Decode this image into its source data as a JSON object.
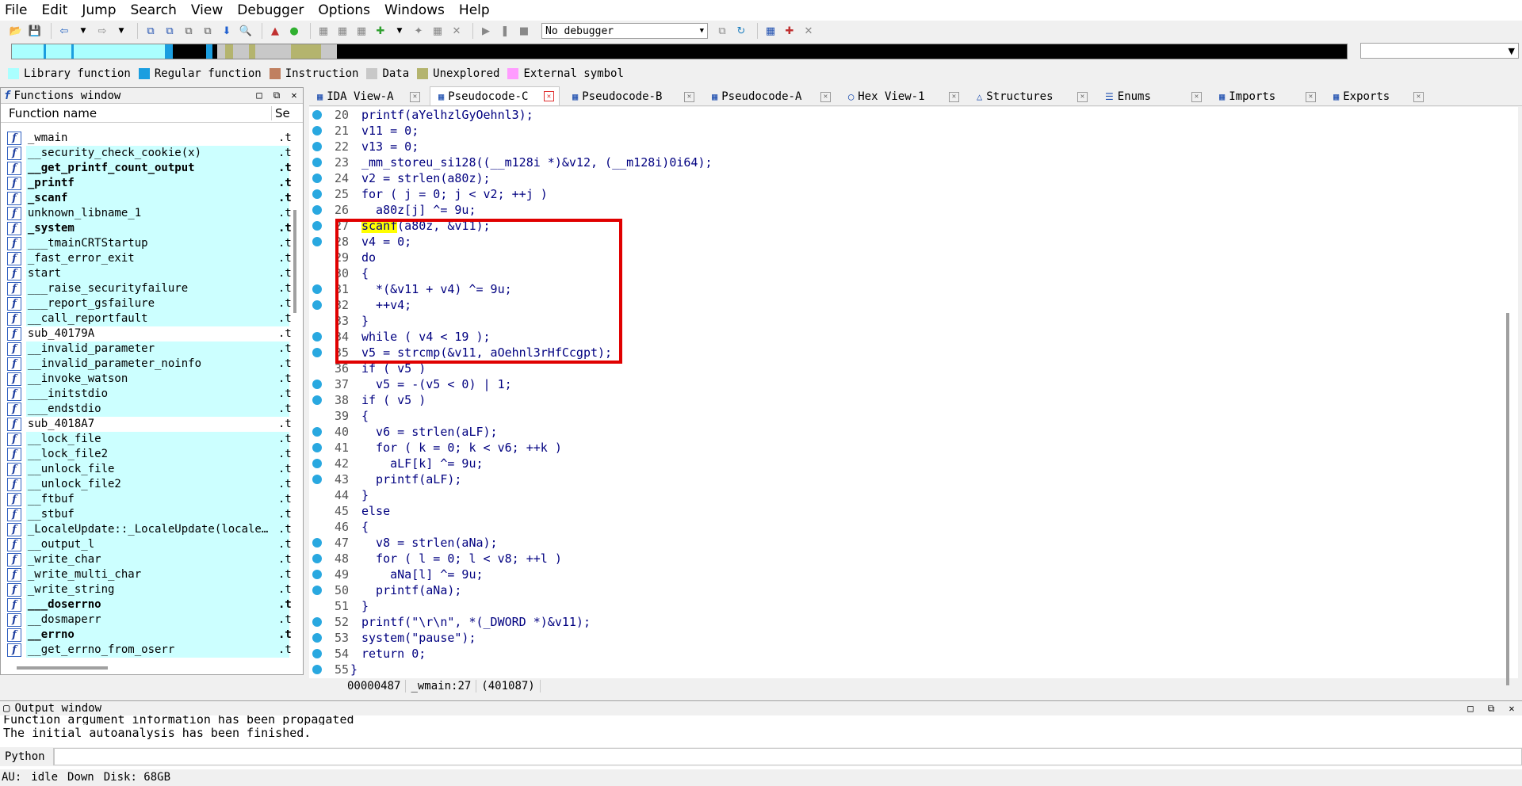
{
  "menu": [
    "File",
    "Edit",
    "Jump",
    "Search",
    "View",
    "Debugger",
    "Options",
    "Windows",
    "Help"
  ],
  "toolbar": {
    "debugger_select": "No debugger"
  },
  "legend": [
    {
      "label": "Library function",
      "color": "#aaffff"
    },
    {
      "label": "Regular function",
      "color": "#1a9ee0"
    },
    {
      "label": "Instruction",
      "color": "#c08060"
    },
    {
      "label": "Data",
      "color": "#c8c8c8"
    },
    {
      "label": "Unexplored",
      "color": "#b4b46e"
    },
    {
      "label": "External symbol",
      "color": "#ff9cff"
    }
  ],
  "functions_window": {
    "title": "Functions window",
    "col_name": "Function name",
    "col_seg": "Se",
    "rows": [
      {
        "name": "_wmain",
        "seg": ".t",
        "lib": false,
        "bold": false
      },
      {
        "name": "__security_check_cookie(x)",
        "seg": ".t",
        "lib": true,
        "bold": false
      },
      {
        "name": "__get_printf_count_output",
        "seg": ".t",
        "lib": true,
        "bold": true
      },
      {
        "name": "_printf",
        "seg": ".t",
        "lib": true,
        "bold": true
      },
      {
        "name": "_scanf",
        "seg": ".t",
        "lib": true,
        "bold": true
      },
      {
        "name": "unknown_libname_1",
        "seg": ".t",
        "lib": true,
        "bold": false
      },
      {
        "name": "_system",
        "seg": ".t",
        "lib": true,
        "bold": true
      },
      {
        "name": "___tmainCRTStartup",
        "seg": ".t",
        "lib": true,
        "bold": false
      },
      {
        "name": "_fast_error_exit",
        "seg": ".t",
        "lib": true,
        "bold": false
      },
      {
        "name": "start",
        "seg": ".t",
        "lib": true,
        "bold": false
      },
      {
        "name": "___raise_securityfailure",
        "seg": ".t",
        "lib": true,
        "bold": false
      },
      {
        "name": "___report_gsfailure",
        "seg": ".t",
        "lib": true,
        "bold": false
      },
      {
        "name": "__call_reportfault",
        "seg": ".t",
        "lib": true,
        "bold": false
      },
      {
        "name": "sub_40179A",
        "seg": ".t",
        "lib": false,
        "bold": false
      },
      {
        "name": "__invalid_parameter",
        "seg": ".t",
        "lib": true,
        "bold": false
      },
      {
        "name": "__invalid_parameter_noinfo",
        "seg": ".t",
        "lib": true,
        "bold": false
      },
      {
        "name": "__invoke_watson",
        "seg": ".t",
        "lib": true,
        "bold": false
      },
      {
        "name": "___initstdio",
        "seg": ".t",
        "lib": true,
        "bold": false
      },
      {
        "name": "___endstdio",
        "seg": ".t",
        "lib": true,
        "bold": false
      },
      {
        "name": "sub_4018A7",
        "seg": ".t",
        "lib": false,
        "bold": false
      },
      {
        "name": "__lock_file",
        "seg": ".t",
        "lib": true,
        "bold": false
      },
      {
        "name": "__lock_file2",
        "seg": ".t",
        "lib": true,
        "bold": false
      },
      {
        "name": "__unlock_file",
        "seg": ".t",
        "lib": true,
        "bold": false
      },
      {
        "name": "__unlock_file2",
        "seg": ".t",
        "lib": true,
        "bold": false
      },
      {
        "name": "__ftbuf",
        "seg": ".t",
        "lib": true,
        "bold": false
      },
      {
        "name": "__stbuf",
        "seg": ".t",
        "lib": true,
        "bold": false
      },
      {
        "name": "_LocaleUpdate::_LocaleUpdate(locale…",
        "seg": ".t",
        "lib": true,
        "bold": false
      },
      {
        "name": "__output_l",
        "seg": ".t",
        "lib": true,
        "bold": false
      },
      {
        "name": "_write_char",
        "seg": ".t",
        "lib": true,
        "bold": false
      },
      {
        "name": "_write_multi_char",
        "seg": ".t",
        "lib": true,
        "bold": false
      },
      {
        "name": "_write_string",
        "seg": ".t",
        "lib": true,
        "bold": false
      },
      {
        "name": "___doserrno",
        "seg": ".t",
        "lib": true,
        "bold": true
      },
      {
        "name": "__dosmaperr",
        "seg": ".t",
        "lib": true,
        "bold": false
      },
      {
        "name": "__errno",
        "seg": ".t",
        "lib": true,
        "bold": true
      },
      {
        "name": "__get_errno_from_oserr",
        "seg": ".t",
        "lib": true,
        "bold": false
      }
    ]
  },
  "tabs": [
    {
      "label": "IDA View-A",
      "active": false
    },
    {
      "label": "Pseudocode-C",
      "active": true
    },
    {
      "label": "Pseudocode-B",
      "active": false
    },
    {
      "label": "Pseudocode-A",
      "active": false
    },
    {
      "label": "Hex View-1",
      "active": false
    },
    {
      "label": "Structures",
      "active": false
    },
    {
      "label": "Enums",
      "active": false
    },
    {
      "label": "Imports",
      "active": false
    },
    {
      "label": "Exports",
      "active": false
    }
  ],
  "code_lines": [
    {
      "n": "20",
      "bp": true,
      "text": "printf(aYelhzlGyOehnl3);"
    },
    {
      "n": "21",
      "bp": true,
      "text": "v11 = 0;"
    },
    {
      "n": "22",
      "bp": true,
      "text": "v13 = 0;"
    },
    {
      "n": "23",
      "bp": true,
      "text": "_mm_storeu_si128((__m128i *)&v12, (__m128i)0i64);"
    },
    {
      "n": "24",
      "bp": true,
      "text": "v2 = strlen(a80z);"
    },
    {
      "n": "25",
      "bp": true,
      "text": "for ( j = 0; j < v2; ++j )"
    },
    {
      "n": "26",
      "bp": true,
      "text": "  a80z[j] ^= 9u;"
    },
    {
      "n": "27",
      "bp": true,
      "text": "scanf(a80z, &v11);"
    },
    {
      "n": "28",
      "bp": true,
      "text": "v4 = 0;"
    },
    {
      "n": "29",
      "bp": false,
      "text": "do"
    },
    {
      "n": "30",
      "bp": false,
      "text": "{"
    },
    {
      "n": "31",
      "bp": true,
      "text": "  *(&v11 + v4) ^= 9u;"
    },
    {
      "n": "32",
      "bp": true,
      "text": "  ++v4;"
    },
    {
      "n": "33",
      "bp": false,
      "text": "}"
    },
    {
      "n": "34",
      "bp": true,
      "text": "while ( v4 < 19 );"
    },
    {
      "n": "35",
      "bp": true,
      "text": "v5 = strcmp(&v11, aOehnl3rHfCcgpt);"
    },
    {
      "n": "36",
      "bp": false,
      "text": "if ( v5 )"
    },
    {
      "n": "37",
      "bp": true,
      "text": "  v5 = -(v5 < 0) | 1;"
    },
    {
      "n": "38",
      "bp": true,
      "text": "if ( v5 )"
    },
    {
      "n": "39",
      "bp": false,
      "text": "{"
    },
    {
      "n": "40",
      "bp": true,
      "text": "  v6 = strlen(aLF);"
    },
    {
      "n": "41",
      "bp": true,
      "text": "  for ( k = 0; k < v6; ++k )"
    },
    {
      "n": "42",
      "bp": true,
      "text": "    aLF[k] ^= 9u;"
    },
    {
      "n": "43",
      "bp": true,
      "text": "  printf(aLF);"
    },
    {
      "n": "44",
      "bp": false,
      "text": "}"
    },
    {
      "n": "45",
      "bp": false,
      "text": "else"
    },
    {
      "n": "46",
      "bp": false,
      "text": "{"
    },
    {
      "n": "47",
      "bp": true,
      "text": "  v8 = strlen(aNa);"
    },
    {
      "n": "48",
      "bp": true,
      "text": "  for ( l = 0; l < v8; ++l )"
    },
    {
      "n": "49",
      "bp": true,
      "text": "    aNa[l] ^= 9u;"
    },
    {
      "n": "50",
      "bp": true,
      "text": "  printf(aNa);"
    },
    {
      "n": "51",
      "bp": false,
      "text": "}"
    },
    {
      "n": "52",
      "bp": true,
      "text": "printf(\"\\r\\n\", *(_DWORD *)&v11);"
    },
    {
      "n": "53",
      "bp": true,
      "text": "system(\"pause\");"
    },
    {
      "n": "54",
      "bp": true,
      "text": "return 0;"
    },
    {
      "n": "55",
      "bp": true,
      "text": "}"
    }
  ],
  "code_status": {
    "offset": "00000487",
    "location": "_wmain:27",
    "address": "(401087)"
  },
  "output_window": {
    "title": "Output window",
    "lines": [
      "Function argument information has been propagated",
      "The initial autoanalysis has been finished."
    ],
    "python_label": "Python"
  },
  "status_bar": {
    "au": "AU:",
    "state": "idle",
    "dir": "Down",
    "disk": "Disk: 68GB"
  }
}
